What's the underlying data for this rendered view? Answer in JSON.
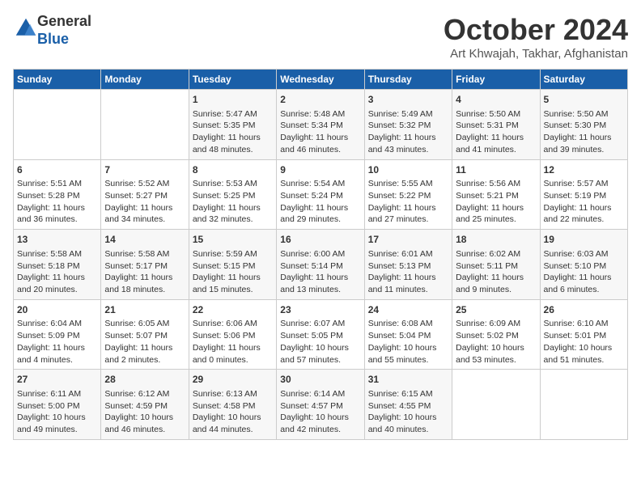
{
  "header": {
    "logo_line1": "General",
    "logo_line2": "Blue",
    "month": "October 2024",
    "location": "Art Khwajah, Takhar, Afghanistan"
  },
  "weekdays": [
    "Sunday",
    "Monday",
    "Tuesday",
    "Wednesday",
    "Thursday",
    "Friday",
    "Saturday"
  ],
  "weeks": [
    [
      {
        "day": "",
        "info": ""
      },
      {
        "day": "",
        "info": ""
      },
      {
        "day": "1",
        "info": "Sunrise: 5:47 AM\nSunset: 5:35 PM\nDaylight: 11 hours and 48 minutes."
      },
      {
        "day": "2",
        "info": "Sunrise: 5:48 AM\nSunset: 5:34 PM\nDaylight: 11 hours and 46 minutes."
      },
      {
        "day": "3",
        "info": "Sunrise: 5:49 AM\nSunset: 5:32 PM\nDaylight: 11 hours and 43 minutes."
      },
      {
        "day": "4",
        "info": "Sunrise: 5:50 AM\nSunset: 5:31 PM\nDaylight: 11 hours and 41 minutes."
      },
      {
        "day": "5",
        "info": "Sunrise: 5:50 AM\nSunset: 5:30 PM\nDaylight: 11 hours and 39 minutes."
      }
    ],
    [
      {
        "day": "6",
        "info": "Sunrise: 5:51 AM\nSunset: 5:28 PM\nDaylight: 11 hours and 36 minutes."
      },
      {
        "day": "7",
        "info": "Sunrise: 5:52 AM\nSunset: 5:27 PM\nDaylight: 11 hours and 34 minutes."
      },
      {
        "day": "8",
        "info": "Sunrise: 5:53 AM\nSunset: 5:25 PM\nDaylight: 11 hours and 32 minutes."
      },
      {
        "day": "9",
        "info": "Sunrise: 5:54 AM\nSunset: 5:24 PM\nDaylight: 11 hours and 29 minutes."
      },
      {
        "day": "10",
        "info": "Sunrise: 5:55 AM\nSunset: 5:22 PM\nDaylight: 11 hours and 27 minutes."
      },
      {
        "day": "11",
        "info": "Sunrise: 5:56 AM\nSunset: 5:21 PM\nDaylight: 11 hours and 25 minutes."
      },
      {
        "day": "12",
        "info": "Sunrise: 5:57 AM\nSunset: 5:19 PM\nDaylight: 11 hours and 22 minutes."
      }
    ],
    [
      {
        "day": "13",
        "info": "Sunrise: 5:58 AM\nSunset: 5:18 PM\nDaylight: 11 hours and 20 minutes."
      },
      {
        "day": "14",
        "info": "Sunrise: 5:58 AM\nSunset: 5:17 PM\nDaylight: 11 hours and 18 minutes."
      },
      {
        "day": "15",
        "info": "Sunrise: 5:59 AM\nSunset: 5:15 PM\nDaylight: 11 hours and 15 minutes."
      },
      {
        "day": "16",
        "info": "Sunrise: 6:00 AM\nSunset: 5:14 PM\nDaylight: 11 hours and 13 minutes."
      },
      {
        "day": "17",
        "info": "Sunrise: 6:01 AM\nSunset: 5:13 PM\nDaylight: 11 hours and 11 minutes."
      },
      {
        "day": "18",
        "info": "Sunrise: 6:02 AM\nSunset: 5:11 PM\nDaylight: 11 hours and 9 minutes."
      },
      {
        "day": "19",
        "info": "Sunrise: 6:03 AM\nSunset: 5:10 PM\nDaylight: 11 hours and 6 minutes."
      }
    ],
    [
      {
        "day": "20",
        "info": "Sunrise: 6:04 AM\nSunset: 5:09 PM\nDaylight: 11 hours and 4 minutes."
      },
      {
        "day": "21",
        "info": "Sunrise: 6:05 AM\nSunset: 5:07 PM\nDaylight: 11 hours and 2 minutes."
      },
      {
        "day": "22",
        "info": "Sunrise: 6:06 AM\nSunset: 5:06 PM\nDaylight: 11 hours and 0 minutes."
      },
      {
        "day": "23",
        "info": "Sunrise: 6:07 AM\nSunset: 5:05 PM\nDaylight: 10 hours and 57 minutes."
      },
      {
        "day": "24",
        "info": "Sunrise: 6:08 AM\nSunset: 5:04 PM\nDaylight: 10 hours and 55 minutes."
      },
      {
        "day": "25",
        "info": "Sunrise: 6:09 AM\nSunset: 5:02 PM\nDaylight: 10 hours and 53 minutes."
      },
      {
        "day": "26",
        "info": "Sunrise: 6:10 AM\nSunset: 5:01 PM\nDaylight: 10 hours and 51 minutes."
      }
    ],
    [
      {
        "day": "27",
        "info": "Sunrise: 6:11 AM\nSunset: 5:00 PM\nDaylight: 10 hours and 49 minutes."
      },
      {
        "day": "28",
        "info": "Sunrise: 6:12 AM\nSunset: 4:59 PM\nDaylight: 10 hours and 46 minutes."
      },
      {
        "day": "29",
        "info": "Sunrise: 6:13 AM\nSunset: 4:58 PM\nDaylight: 10 hours and 44 minutes."
      },
      {
        "day": "30",
        "info": "Sunrise: 6:14 AM\nSunset: 4:57 PM\nDaylight: 10 hours and 42 minutes."
      },
      {
        "day": "31",
        "info": "Sunrise: 6:15 AM\nSunset: 4:55 PM\nDaylight: 10 hours and 40 minutes."
      },
      {
        "day": "",
        "info": ""
      },
      {
        "day": "",
        "info": ""
      }
    ]
  ]
}
